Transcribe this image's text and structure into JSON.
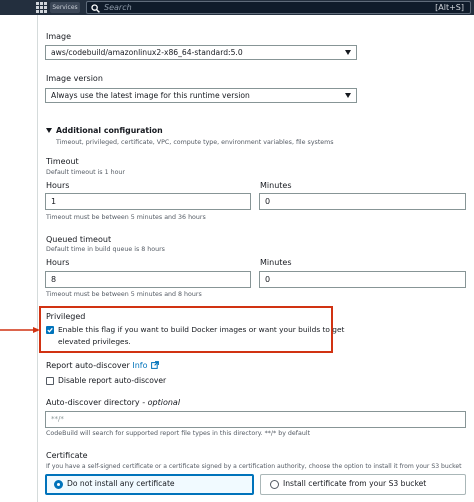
{
  "topbar": {
    "services_label": "Services",
    "search_placeholder": "Search",
    "shortcut": "[Alt+S]"
  },
  "image": {
    "label": "Image",
    "value": "aws/codebuild/amazonlinux2-x86_64-standard:5.0"
  },
  "image_version": {
    "label": "Image version",
    "value": "Always use the latest image for this runtime version"
  },
  "additional_config": {
    "title": "Additional configuration",
    "subtitle": "Timeout, privileged, certificate, VPC, compute type, environment variables, file systems"
  },
  "timeout": {
    "label": "Timeout",
    "hint": "Default timeout is 1 hour",
    "hours_label": "Hours",
    "hours_value": "1",
    "minutes_label": "Minutes",
    "minutes_value": "0",
    "constraint": "Timeout must be between 5 minutes and 36 hours"
  },
  "queued_timeout": {
    "label": "Queued timeout",
    "hint": "Default time in build queue is 8 hours",
    "hours_label": "Hours",
    "hours_value": "8",
    "minutes_label": "Minutes",
    "minutes_value": "0",
    "constraint": "Timeout must be between 5 minutes and 8 hours"
  },
  "privileged": {
    "label": "Privileged",
    "checkbox_line1": "Enable this flag if you want to build Docker images or want your builds to get",
    "checkbox_line2": "elevated privileges.",
    "checked": true
  },
  "report_auto_discover": {
    "label": "Report auto-discover",
    "info_link": "Info",
    "checkbox_label": "Disable report auto-discover",
    "checked": false
  },
  "auto_discover_dir": {
    "label": "Auto-discover directory",
    "optional": " - optional",
    "placeholder": "**/*",
    "hint": "CodeBuild will search for supported report file types in this directory. **/* by default"
  },
  "certificate": {
    "label": "Certificate",
    "hint": "If you have a self-signed certificate or a certificate signed by a certification authority, choose the option to install it from your S3 bucket",
    "option_none": "Do not install any certificate",
    "option_s3": "Install certificate from your S3 bucket",
    "selected": "none"
  },
  "colors": {
    "accent": "#0073bb",
    "highlight": "#d13212",
    "topbar": "#232f3e"
  }
}
